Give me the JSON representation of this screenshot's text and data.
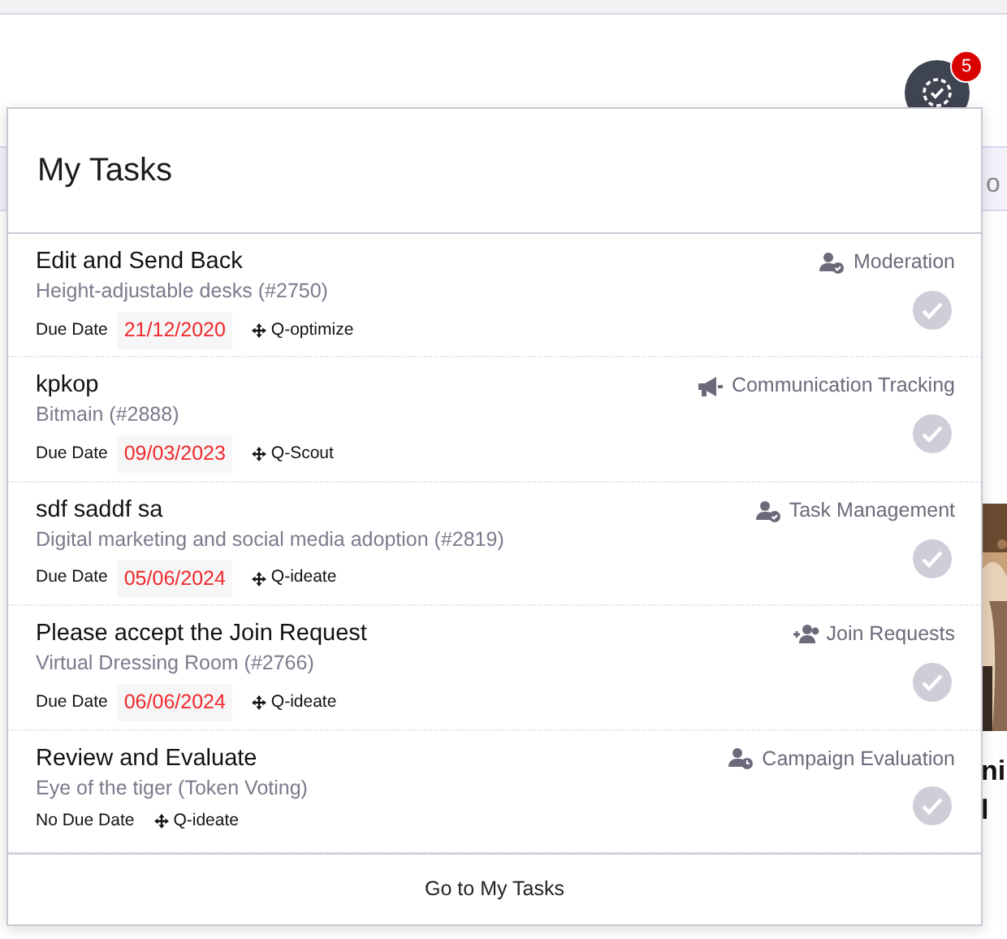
{
  "header": {
    "tasks_badge": "5"
  },
  "background_texts": [
    {
      "text": "o",
      "kind": "side"
    },
    {
      "text": "ni",
      "kind": "heading"
    },
    {
      "text": "l",
      "kind": "heading"
    }
  ],
  "popup": {
    "title": "My Tasks",
    "tasks": [
      {
        "title": "Edit and Send Back",
        "subtitle": "Height-adjustable desks (#2750)",
        "due_label": "Due Date",
        "due_date": "21/12/2020",
        "module": "Q-optimize",
        "category": "Moderation",
        "kind": "user-check",
        "completed": false
      },
      {
        "title": "kpkop",
        "subtitle": "Bitmain (#2888)",
        "due_label": "Due Date",
        "due_date": "09/03/2023",
        "module": "Q-Scout",
        "category": "Communication Tracking",
        "kind": "megaphone",
        "completed": false
      },
      {
        "title": "sdf saddf sa",
        "subtitle": "Digital marketing and social media adoption (#2819)",
        "due_label": "Due Date",
        "due_date": "05/06/2024",
        "module": "Q-ideate",
        "category": "Task Management",
        "kind": "user-check",
        "completed": false
      },
      {
        "title": "Please accept the Join Request",
        "subtitle": "Virtual Dressing Room (#2766)",
        "due_label": "Due Date",
        "due_date": "06/06/2024",
        "module": "Q-ideate",
        "category": "Join Requests",
        "kind": "user-plus",
        "completed": false
      },
      {
        "title": "Review and Evaluate",
        "subtitle": "Eye of the tiger (Token Voting)",
        "due_label": "No Due Date",
        "module": "Q-ideate",
        "category": "Campaign Evaluation",
        "kind": "user-clock",
        "completed": false
      }
    ],
    "footer_link": "Go to My Tasks"
  }
}
